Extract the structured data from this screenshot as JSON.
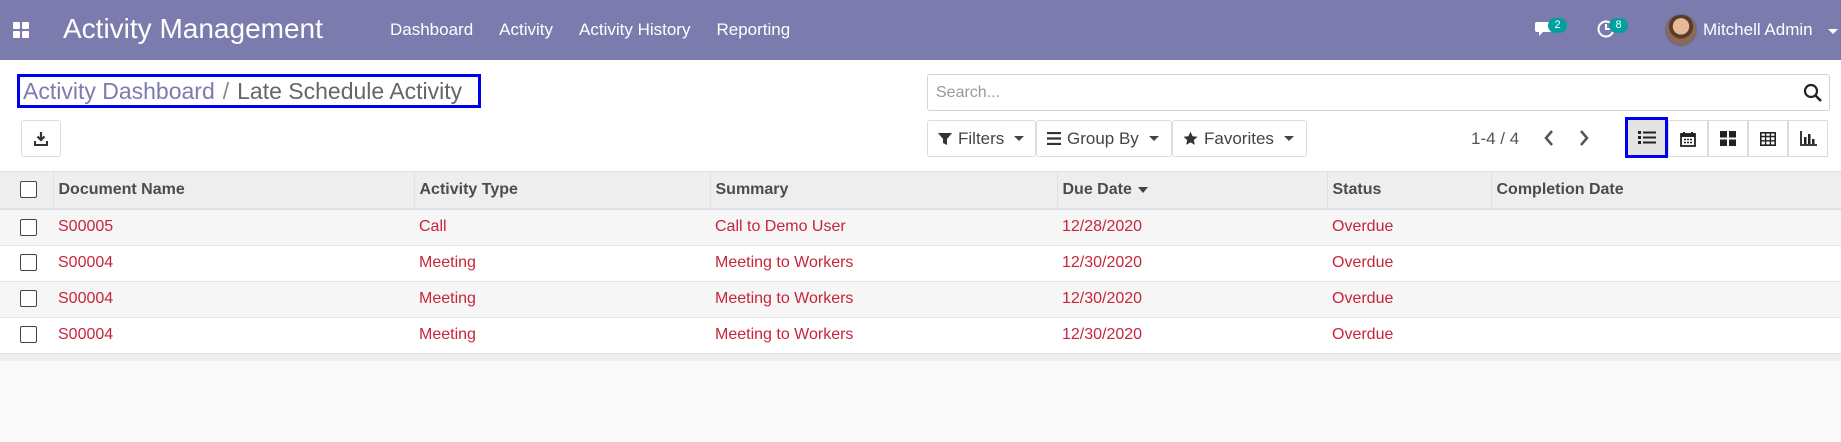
{
  "navbar": {
    "app_title": "Activity Management",
    "menu": [
      "Dashboard",
      "Activity",
      "Activity History",
      "Reporting"
    ],
    "messages_count": "2",
    "activities_count": "8",
    "user_name": "Mitchell Admin"
  },
  "breadcrumb": {
    "parent": "Activity Dashboard",
    "separator": "/",
    "current": "Late Schedule Activity"
  },
  "search": {
    "placeholder": "Search..."
  },
  "filters": {
    "filters_label": "Filters",
    "group_by_label": "Group By",
    "favorites_label": "Favorites"
  },
  "pager": {
    "value": "1-4 / 4"
  },
  "views": {
    "active": "list",
    "items": [
      "list",
      "calendar",
      "kanban",
      "pivot",
      "graph"
    ]
  },
  "table": {
    "columns": [
      "Document Name",
      "Activity Type",
      "Summary",
      "Due Date",
      "Status",
      "Completion Date"
    ],
    "sorted_column": "Due Date",
    "rows": [
      {
        "document": "S00005",
        "type": "Call",
        "summary": "Call to Demo User",
        "due": "12/28/2020",
        "status": "Overdue",
        "completion": ""
      },
      {
        "document": "S00004",
        "type": "Meeting",
        "summary": "Meeting to Workers",
        "due": "12/30/2020",
        "status": "Overdue",
        "completion": ""
      },
      {
        "document": "S00004",
        "type": "Meeting",
        "summary": "Meeting to Workers",
        "due": "12/30/2020",
        "status": "Overdue",
        "completion": ""
      },
      {
        "document": "S00004",
        "type": "Meeting",
        "summary": "Meeting to Workers",
        "due": "12/30/2020",
        "status": "Overdue",
        "completion": ""
      }
    ]
  },
  "colors": {
    "navbar": "#7c7bad",
    "overdue_text": "#c7253b",
    "badge": "#00a09d",
    "highlight_border": "#0000ee"
  }
}
